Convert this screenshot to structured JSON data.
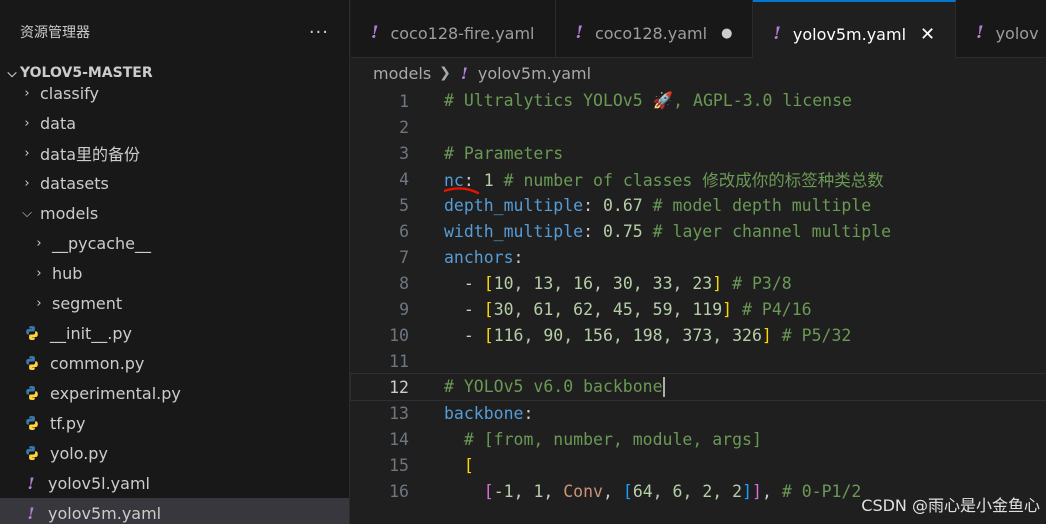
{
  "sidebar": {
    "title": "资源管理器",
    "more": "···",
    "project": "YOLOV5-MASTER",
    "items": [
      {
        "label": "classify",
        "kind": "folder",
        "level": 1
      },
      {
        "label": "data",
        "kind": "folder",
        "level": 1
      },
      {
        "label": "data里的备份",
        "kind": "folder",
        "level": 1
      },
      {
        "label": "datasets",
        "kind": "folder",
        "level": 1
      },
      {
        "label": "models",
        "kind": "folder-open",
        "level": 1
      },
      {
        "label": "__pycache__",
        "kind": "folder",
        "level": 2
      },
      {
        "label": "hub",
        "kind": "folder",
        "level": 2
      },
      {
        "label": "segment",
        "kind": "folder",
        "level": 2
      },
      {
        "label": "__init__.py",
        "kind": "py",
        "level": 2
      },
      {
        "label": "common.py",
        "kind": "py",
        "level": 2
      },
      {
        "label": "experimental.py",
        "kind": "py",
        "level": 2
      },
      {
        "label": "tf.py",
        "kind": "py",
        "level": 2
      },
      {
        "label": "yolo.py",
        "kind": "py",
        "level": 2
      },
      {
        "label": "yolov5l.yaml",
        "kind": "yaml",
        "level": 2
      },
      {
        "label": "yolov5m.yaml",
        "kind": "yaml",
        "level": 2,
        "selected": true
      }
    ]
  },
  "tabs": [
    {
      "label": "coco128-fire.yaml",
      "state": "normal"
    },
    {
      "label": "coco128.yaml",
      "state": "modified"
    },
    {
      "label": "yolov5m.yaml",
      "state": "active"
    },
    {
      "label": "yolov",
      "state": "normal"
    }
  ],
  "tab_icon": "!",
  "tab_modified_glyph": "●",
  "tab_close_glyph": "✕",
  "breadcrumb": {
    "folder": "models",
    "file": "yolov5m.yaml"
  },
  "editor": {
    "current_line": 12,
    "lines": [
      {
        "n": "1"
      },
      {
        "n": "2"
      },
      {
        "n": "3"
      },
      {
        "n": "4"
      },
      {
        "n": "5"
      },
      {
        "n": "6"
      },
      {
        "n": "7"
      },
      {
        "n": "8"
      },
      {
        "n": "9"
      },
      {
        "n": "10"
      },
      {
        "n": "11"
      },
      {
        "n": "12"
      },
      {
        "n": "13"
      },
      {
        "n": "14"
      },
      {
        "n": "15"
      },
      {
        "n": "16"
      }
    ],
    "code": {
      "l1": "# Ultralytics YOLOv5 🚀, AGPL-3.0 license",
      "l3": "# Parameters",
      "l4_key": "nc",
      "l4_val": "1",
      "l4_comment": "# number of classes 修改成你的标签种类总数",
      "l5_key": "depth_multiple",
      "l5_val": "0.67",
      "l5_comment": "# model depth multiple",
      "l6_key": "width_multiple",
      "l6_val": "0.75",
      "l6_comment": "# layer channel multiple",
      "l7_key": "anchors",
      "l8_vals": "10, 13, 16, 30, 33, 23",
      "l8_comment": "# P3/8",
      "l9_vals": "30, 61, 62, 45, 59, 119",
      "l9_comment": "# P4/16",
      "l10_vals": "116, 90, 156, 198, 373, 326",
      "l10_comment": "# P5/32",
      "l12": "# YOLOv5 v6.0 backbone",
      "l13_key": "backbone",
      "l14": "# [from, number, module, args]",
      "l15": "[",
      "l16_a": "-1",
      "l16_b": "1",
      "l16_c": "Conv",
      "l16_d": "64, 6, 2, 2",
      "l16_comment": "# 0-P1/2"
    }
  },
  "watermark": "CSDN @雨心是小金鱼心",
  "colors": {
    "accent": "#0078d4",
    "yaml_icon": "#b180d7",
    "annotation": "#e51400"
  }
}
